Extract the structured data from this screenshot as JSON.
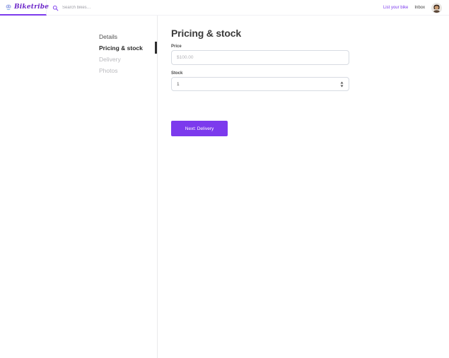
{
  "brand": {
    "name": "Biketribe",
    "logo_icon": "bike-helmet-icon"
  },
  "colors": {
    "accent": "#7c3aed",
    "logo_purple": "#6d28c9",
    "active_step_bar": "#2e2e2e",
    "button_text": "#ffffff",
    "muted_step": "#b9b9bd"
  },
  "topbar": {
    "search": {
      "placeholder": "Search bikes…",
      "icon": "search-icon"
    },
    "links": {
      "list_your_bike": "List your bike",
      "inbox": "Inbox"
    },
    "avatar": "user-avatar"
  },
  "wizard": {
    "steps": [
      {
        "label": "Details",
        "state": "completed"
      },
      {
        "label": "Pricing & stock",
        "state": "active"
      },
      {
        "label": "Delivery",
        "state": "upcoming"
      },
      {
        "label": "Photos",
        "state": "upcoming"
      }
    ]
  },
  "panel": {
    "title": "Pricing & stock",
    "fields": [
      {
        "label": "Price",
        "placeholder": "$100.00",
        "value": ""
      },
      {
        "label": "Stock",
        "value": "1"
      }
    ],
    "submit_label": "Next: Delivery"
  }
}
